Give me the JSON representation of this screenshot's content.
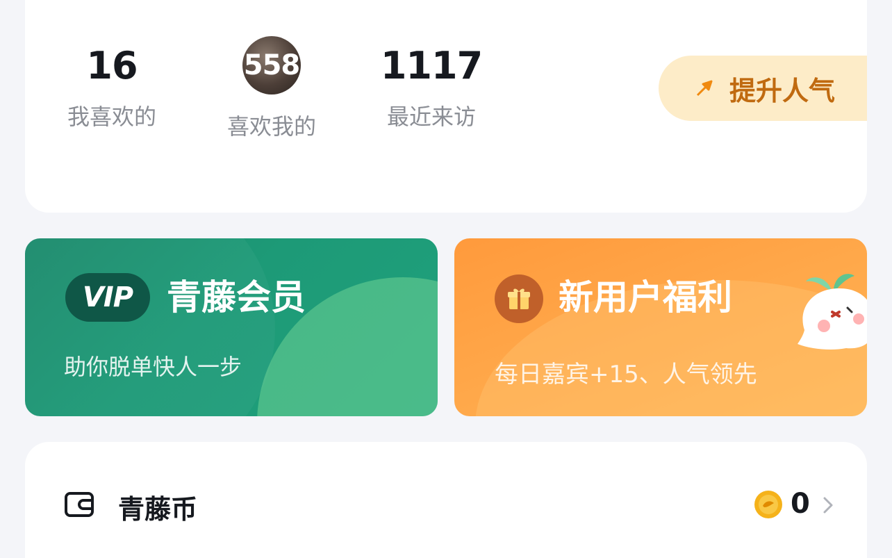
{
  "stats": {
    "likes": {
      "value": "16",
      "label": "我喜欢的"
    },
    "liked_me": {
      "value": "558",
      "label": "喜欢我的"
    },
    "visitors": {
      "value": "1117",
      "label": "最近来访"
    }
  },
  "boost": {
    "label": "提升人气",
    "icon": "arrow-up-right-icon"
  },
  "promos": {
    "vip": {
      "badge": "VIP",
      "title": "青藤会员",
      "subtitle": "助你脱单快人一步"
    },
    "new_user": {
      "title": "新用户福利",
      "subtitle": "每日嘉宾+15、人气领先",
      "icon": "gift-icon"
    }
  },
  "wallet": {
    "title": "青藤币",
    "count": "0",
    "icon": "wallet-icon"
  },
  "colors": {
    "vip_green": "#1d9a77",
    "promo_orange": "#ffa84a",
    "boost_bg": "#fdecc8",
    "boost_text": "#c06a10",
    "coin_gold": "#f5b21a"
  }
}
